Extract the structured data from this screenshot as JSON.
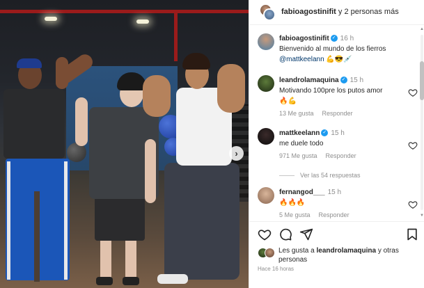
{
  "header": {
    "username": "fabioagostinifit",
    "others": "y 2 personas más"
  },
  "caption": {
    "username": "fabioagostinifit",
    "time": "16 h",
    "text": "Bienvenido al mundo de los fierros",
    "mention": "@mattkeelann",
    "emojis": "💪😎💉"
  },
  "comments": [
    {
      "username": "leandrolamaquina",
      "verified": true,
      "time": "15 h",
      "text": "Motivando 100pre los putos amor",
      "emojis": "🔥💪",
      "likes": "13 Me gusta",
      "reply": "Responder"
    },
    {
      "username": "mattkeelann",
      "verified": true,
      "time": "15 h",
      "text": "me duele todo",
      "emojis": "",
      "likes": "971 Me gusta",
      "reply": "Responder",
      "view_replies": "Ver las 54 respuestas"
    },
    {
      "username": "fernangod___",
      "verified": false,
      "time": "15 h",
      "text": "",
      "emojis": "🔥🔥🔥",
      "likes": "5 Me gusta",
      "reply": "Responder"
    }
  ],
  "likes": {
    "prefix": "Les gusta a ",
    "user": "leandrolamaquina",
    "suffix": " y otras personas"
  },
  "ago": "Hace 16 horas",
  "photo": {
    "next_symbol": "›"
  },
  "colors": {
    "verified": "#1d9bf0",
    "mention": "#00376b",
    "muted": "#8e8e8e"
  }
}
